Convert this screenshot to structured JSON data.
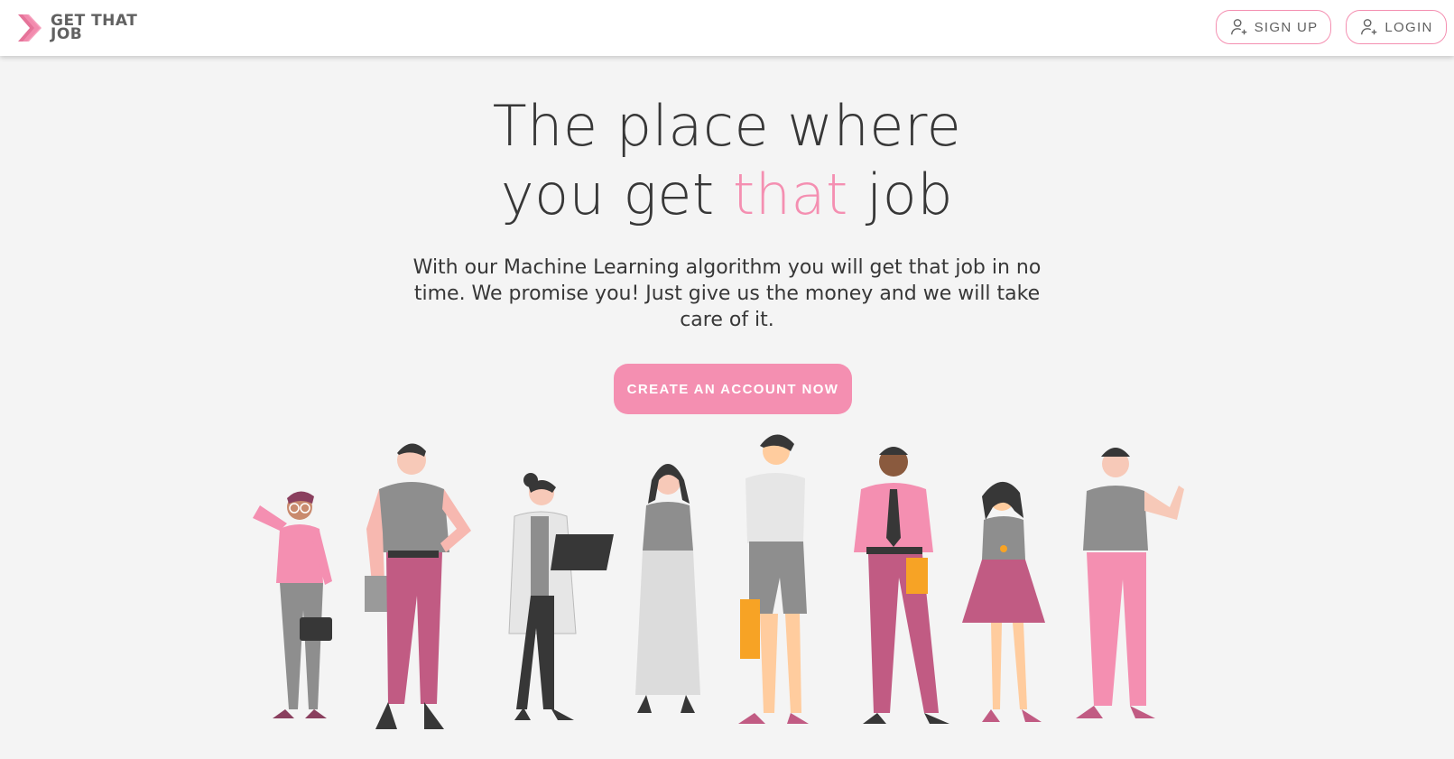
{
  "header": {
    "logo_text": "GET THAT\nJOB",
    "logo_icon": "chevron-right-logo-icon",
    "signup_label": "SIGN UP",
    "login_label": "LOGIN",
    "user_add_icon": "user-plus-icon"
  },
  "hero": {
    "title_line1": "The place where",
    "title_line2_before": "you get ",
    "title_line2_accent": "that",
    "title_line2_after": " job",
    "subtitle": "With our Machine Learning algorithm you will get that job in no time. We promise you! Just give us the money and we will take care of it.",
    "cta_label": "CREATE AN ACCOUNT NOW"
  },
  "colors": {
    "accent": "#f48fb1",
    "text": "#373737",
    "background": "#f4f4f4",
    "logo_text": "#616161"
  },
  "illustration": {
    "description_name": "people-group-illustration"
  }
}
